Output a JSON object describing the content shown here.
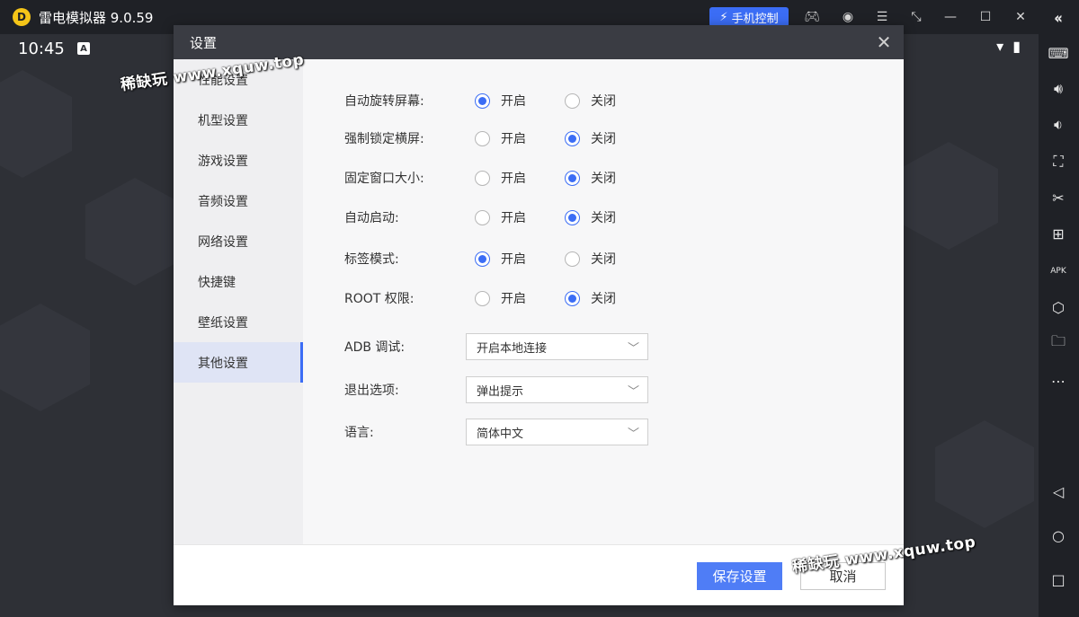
{
  "app": {
    "logo_letter": "D",
    "title": "雷电模拟器 9.0.59",
    "phone_control": "手机控制"
  },
  "status": {
    "time": "10:45",
    "badge": "A"
  },
  "dialog": {
    "title": "设置",
    "nav": [
      "性能设置",
      "机型设置",
      "游戏设置",
      "音频设置",
      "网络设置",
      "快捷键",
      "壁纸设置",
      "其他设置"
    ],
    "active_nav": 7,
    "rows": [
      {
        "label": "自动旋转屏幕:",
        "on": "开启",
        "off": "关闭",
        "selected": "on"
      },
      {
        "label": "强制锁定横屏:",
        "on": "开启",
        "off": "关闭",
        "selected": "off"
      },
      {
        "label": "固定窗口大小:",
        "on": "开启",
        "off": "关闭",
        "selected": "off"
      },
      {
        "label": "自动启动:",
        "on": "开启",
        "off": "关闭",
        "selected": "off"
      },
      {
        "label": "标签模式:",
        "on": "开启",
        "off": "关闭",
        "selected": "on"
      },
      {
        "label": "ROOT 权限:",
        "on": "开启",
        "off": "关闭",
        "selected": "off"
      }
    ],
    "selects": [
      {
        "label": "ADB 调试:",
        "value": "开启本地连接"
      },
      {
        "label": "退出选项:",
        "value": "弹出提示"
      },
      {
        "label": "语言:",
        "value": "简体中文"
      }
    ],
    "save_label": "保存设置",
    "cancel_label": "取消"
  },
  "watermark": "稀缺玩 www.xquw.top",
  "icons": {
    "titlebar": [
      "gamepad-icon",
      "user-icon",
      "menu-icon",
      "resize-icon",
      "minimize-icon",
      "maximize-icon",
      "close-icon"
    ],
    "sidebar": [
      "collapse-icon",
      "keyboard-icon",
      "volume-up-icon",
      "volume-down-icon",
      "fullscreen-icon",
      "scissors-icon",
      "add-window-icon",
      "apk-icon",
      "settings-hex-icon",
      "folder-icon",
      "more-icon",
      "back-icon",
      "home-icon",
      "recents-icon"
    ]
  },
  "colors": {
    "accent": "#3b6df5",
    "titlebar": "#1f2126",
    "dialog_header": "#3a3c43"
  }
}
